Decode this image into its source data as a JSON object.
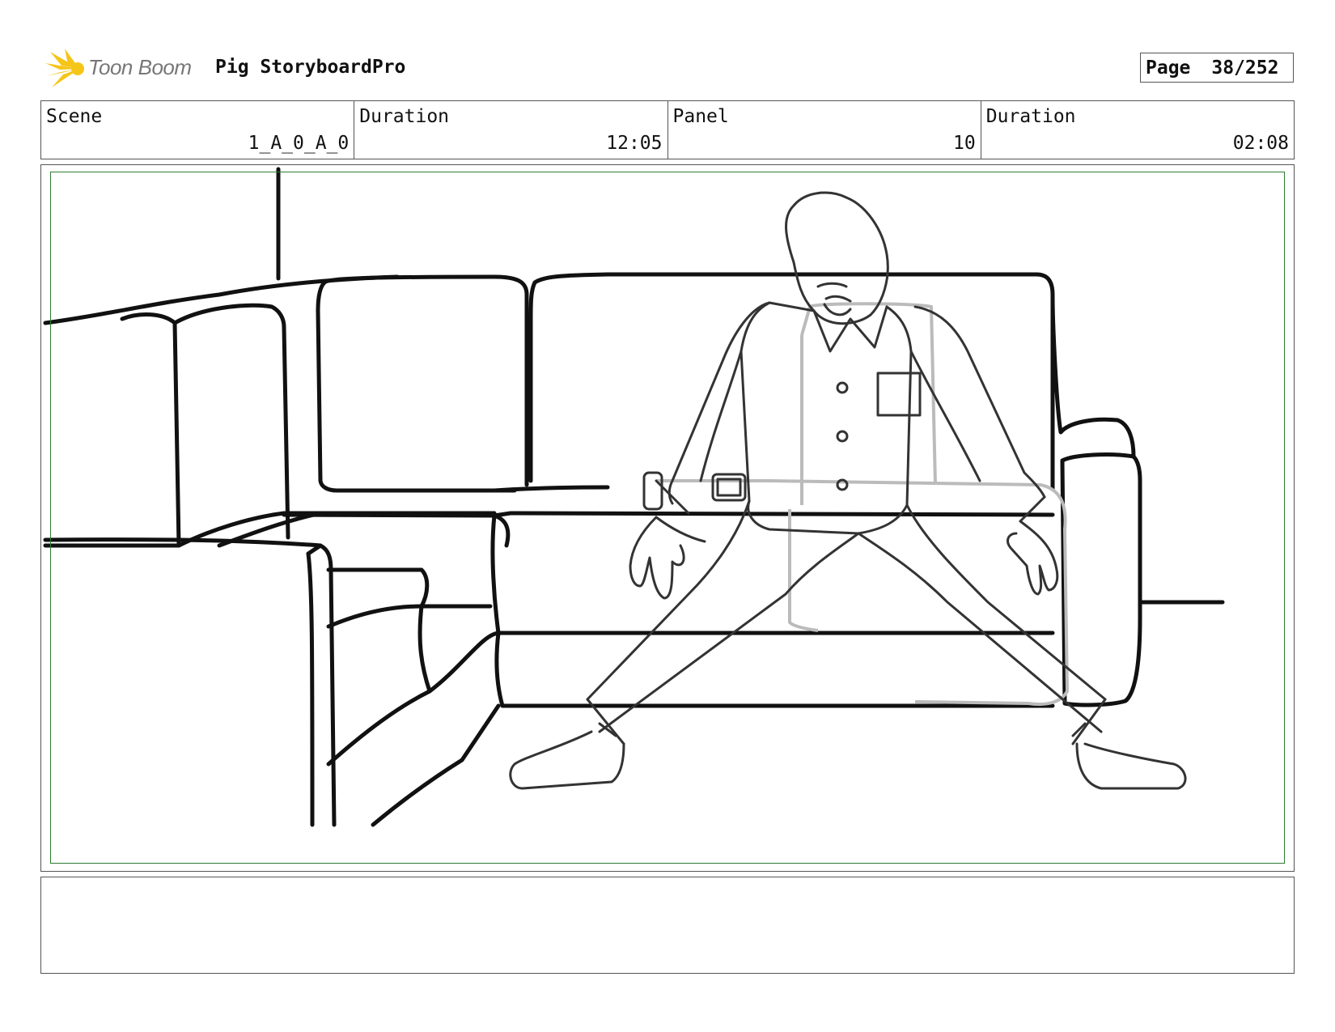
{
  "header": {
    "logo_text": "Toon Boom",
    "project_title": "Pig StoryboardPro",
    "page_label": "Page",
    "page_value": "38/252"
  },
  "info": {
    "scene_label": "Scene",
    "scene_value": "1_A_0_A_0",
    "scene_duration_label": "Duration",
    "scene_duration_value": "12:05",
    "panel_label": "Panel",
    "panel_value": "10",
    "panel_duration_label": "Duration",
    "panel_duration_value": "02:08"
  },
  "colors": {
    "safe_area": "#2e7d32",
    "logo_accent": "#f5c518"
  }
}
